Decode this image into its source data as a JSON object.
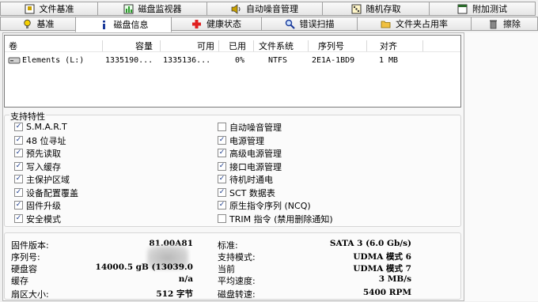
{
  "tabs_row1": [
    {
      "label": "文件基准",
      "icon": "file-benchmark-icon"
    },
    {
      "label": "磁盘监视器",
      "icon": "disk-monitor-icon"
    },
    {
      "label": "自动噪音管理",
      "icon": "speaker-icon"
    },
    {
      "label": "随机存取",
      "icon": "random-access-icon"
    },
    {
      "label": "附加测试",
      "icon": "extra-tests-icon"
    }
  ],
  "tabs_row2": [
    {
      "label": "基准",
      "icon": "lightbulb-icon"
    },
    {
      "label": "磁盘信息",
      "icon": "info-icon",
      "active": true
    },
    {
      "label": "健康状态",
      "icon": "health-cross-icon"
    },
    {
      "label": "错误扫描",
      "icon": "magnifier-icon"
    },
    {
      "label": "文件夹占用率",
      "icon": "folder-icon"
    },
    {
      "label": "擦除",
      "icon": "trash-icon"
    }
  ],
  "drive_table": {
    "headers": {
      "volume": "卷",
      "capacity": "容量",
      "available": "可用",
      "used": "已用",
      "filesystem": "文件系统",
      "serial": "序列号",
      "alignment": "对齐"
    },
    "rows": [
      {
        "volume": "Elements (L:)",
        "capacity": "1335190...",
        "available": "1335136...",
        "used": "0%",
        "filesystem": "NTFS",
        "serial": "2E1A-1BD9",
        "alignment": "1 MB"
      }
    ]
  },
  "features": {
    "title": "支持特性",
    "left": [
      {
        "label": "S.M.A.R.T",
        "checked": true
      },
      {
        "label": "48 位寻址",
        "checked": true
      },
      {
        "label": "预先读取",
        "checked": true
      },
      {
        "label": "写入缓存",
        "checked": true
      },
      {
        "label": "主保护区域",
        "checked": true
      },
      {
        "label": "设备配置覆盖",
        "checked": true
      },
      {
        "label": "固件升级",
        "checked": true
      },
      {
        "label": "安全模式",
        "checked": true
      }
    ],
    "right": [
      {
        "label": "自动噪音管理",
        "checked": false
      },
      {
        "label": "电源管理",
        "checked": true
      },
      {
        "label": "高级电源管理",
        "checked": true
      },
      {
        "label": "接口电源管理",
        "checked": true
      },
      {
        "label": "待机时通电",
        "checked": true
      },
      {
        "label": "SCT 数据表",
        "checked": true
      },
      {
        "label": "原生指令序列 (NCQ)",
        "checked": true
      },
      {
        "label": "TRIM 指令 (禁用删除通知)",
        "checked": false
      }
    ]
  },
  "details": {
    "left": [
      {
        "label": "固件版本:",
        "value": "81.00A81"
      },
      {
        "label": "序列号:",
        "value": ""
      },
      {
        "label": "硬盘容",
        "value": "14000.5 gB (13039.0"
      },
      {
        "label": "缓存",
        "value": "n/a"
      },
      {
        "label": "扇区大小:",
        "value": "512 字节"
      }
    ],
    "right": [
      {
        "label": "标准:",
        "value": "SATA 3 (6.0 Gb/s)"
      },
      {
        "label": "支持模式:",
        "value": "UDMA 模式 6"
      },
      {
        "label": "当前",
        "value": "UDMA 模式 7"
      },
      {
        "label": "平均速度:",
        "value": "3 MB/s"
      },
      {
        "label": "磁盘转速:",
        "value": "5400 RPM"
      }
    ]
  },
  "colors": {
    "checkmark": "#1a3a8a",
    "tab_border": "#a0a0a0"
  }
}
